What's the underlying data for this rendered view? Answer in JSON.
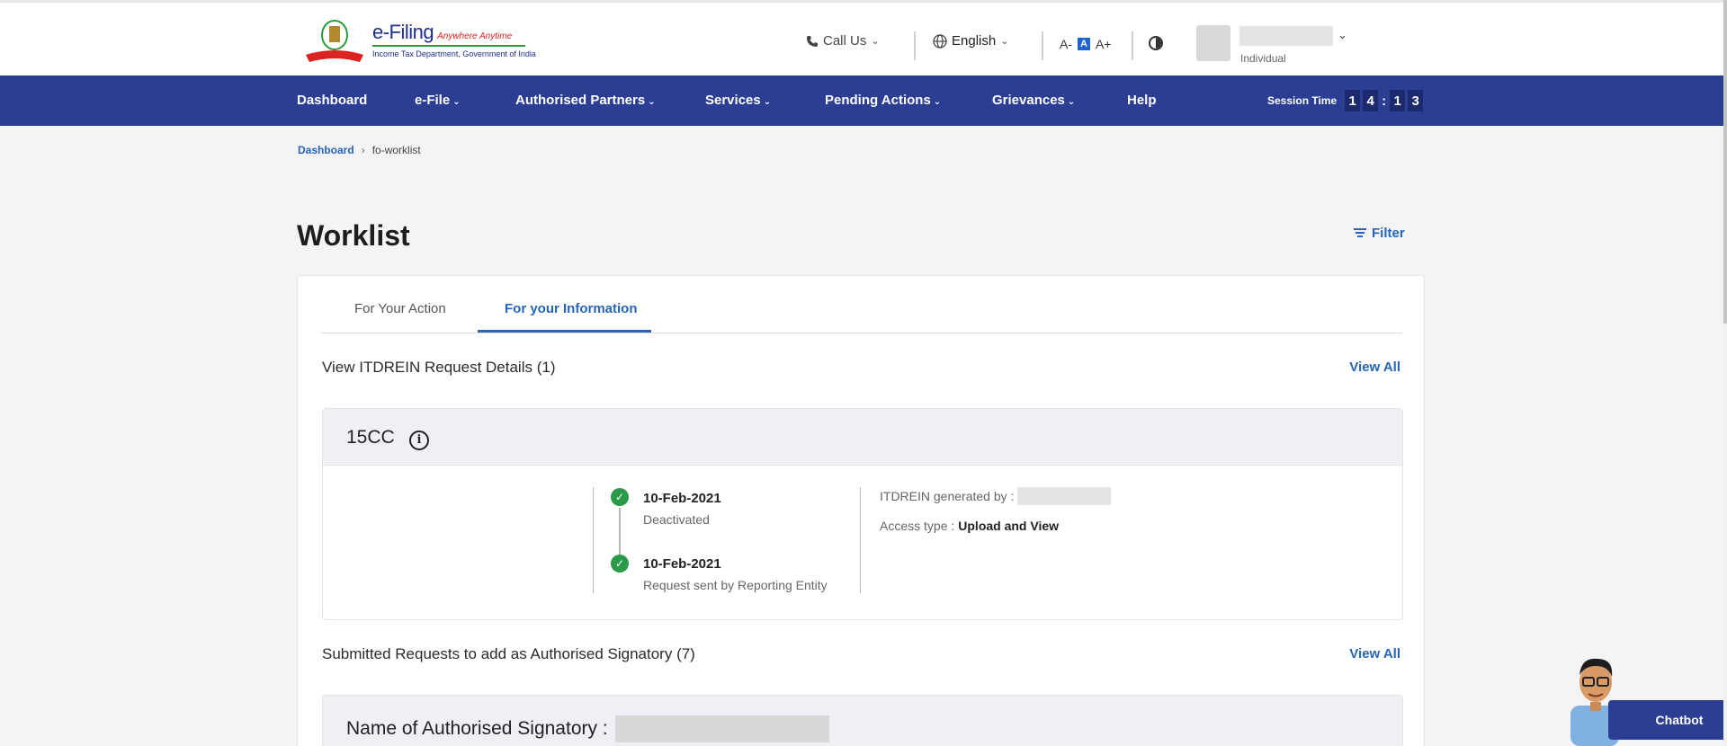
{
  "header": {
    "logo_title": "e-Filing",
    "logo_tagline": "Anywhere Anytime",
    "logo_sub": "Income Tax Department, Government of India",
    "call_us": "Call Us",
    "language": "English",
    "font_small": "A-",
    "font_normal": "A",
    "font_large": "A+",
    "user_role": "Individual"
  },
  "nav": {
    "items": [
      "Dashboard",
      "e-File",
      "Authorised Partners",
      "Services",
      "Pending Actions",
      "Grievances",
      "Help"
    ],
    "session_label": "Session Time",
    "session_digits": [
      "1",
      "4",
      "1",
      "3"
    ]
  },
  "breadcrumb": {
    "home": "Dashboard",
    "current": "fo-worklist"
  },
  "page": {
    "title": "Worklist",
    "filter": "Filter"
  },
  "tabs": [
    "For Your Action",
    "For your Information"
  ],
  "itdrein": {
    "title": "View ITDREIN Request Details (1)",
    "view_all": "View All",
    "form_name": "15CC",
    "timeline": [
      {
        "date": "10-Feb-2021",
        "desc": "Deactivated"
      },
      {
        "date": "10-Feb-2021",
        "desc": "Request sent by Reporting Entity"
      }
    ],
    "generated_by_label": "ITDREIN generated by :",
    "access_type_label": "Access type :",
    "access_type_value": "Upload and View"
  },
  "signatory": {
    "title": "Submitted Requests to add as Authorised Signatory (7)",
    "view_all": "View All",
    "name_label": "Name of Authorised Signatory :"
  },
  "chatbot": {
    "label": "Chatbot"
  },
  "colors": {
    "nav_bg": "#2c3e93",
    "link": "#2665b7",
    "success": "#2b9b4a"
  }
}
